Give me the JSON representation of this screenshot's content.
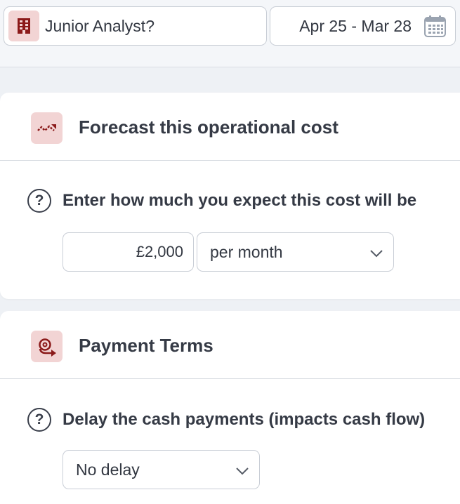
{
  "header": {
    "role_value": "Junior Analyst?",
    "date_range": "Apr 25 - Mar 28",
    "icons": {
      "role": "building-icon",
      "date": "calendar-icon"
    }
  },
  "forecast": {
    "title": "Forecast this operational cost",
    "icon": "trend-arrow-icon",
    "question": "Enter how much you expect this cost will be",
    "amount": "£2,000",
    "period": "per month"
  },
  "payment_terms": {
    "title": "Payment Terms",
    "icon": "payment-delay-icon",
    "question": "Delay the cash payments (impacts cash flow)",
    "delay": "No delay"
  },
  "colors": {
    "accent": "#8b1a1a",
    "accent_bg": "#f2d4d4",
    "page_bg": "#eef1f5"
  }
}
